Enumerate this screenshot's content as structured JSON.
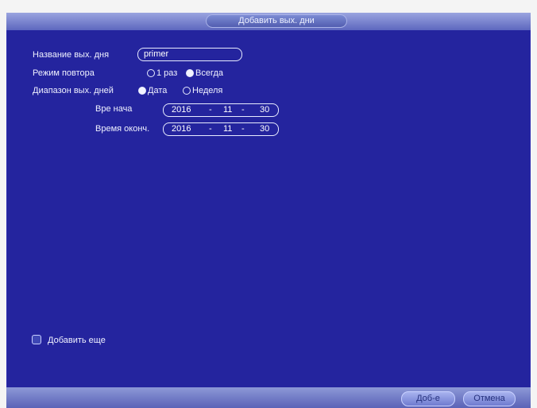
{
  "dialog": {
    "title": "Добавить вых. дни"
  },
  "form": {
    "name": {
      "label": "Название вых. дня",
      "value": "primer"
    },
    "repeat_mode": {
      "label": "Режим повтора",
      "options": [
        {
          "label": "1 раз",
          "selected": false
        },
        {
          "label": "Всегда",
          "selected": true
        }
      ]
    },
    "range": {
      "label": "Диапазон вых. дней",
      "options": [
        {
          "label": "Дата",
          "selected": true
        },
        {
          "label": "Неделя",
          "selected": false
        }
      ]
    },
    "start": {
      "label": "Вре нача",
      "year": "2016",
      "month": "11",
      "day": "30",
      "sep": "-"
    },
    "end": {
      "label": "Время оконч.",
      "year": "2016",
      "month": "11",
      "day": "30",
      "sep": "-"
    },
    "add_more": {
      "label": "Добавить еще",
      "checked": false
    }
  },
  "footer": {
    "add_label": "Доб-е",
    "cancel_label": "Отмена"
  },
  "colors": {
    "background": "#24249e",
    "text": "#f0f2ff"
  }
}
